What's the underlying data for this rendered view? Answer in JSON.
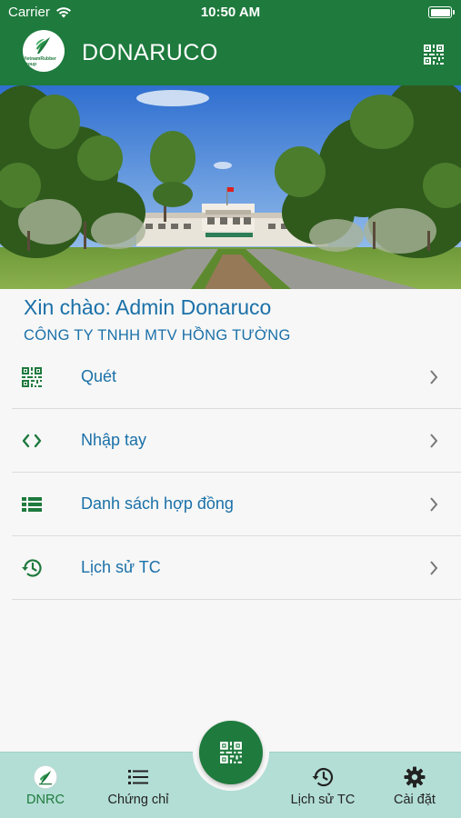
{
  "status_bar": {
    "carrier": "Carrier",
    "time": "10:50 AM"
  },
  "app_bar": {
    "title": "DONARUCO",
    "logo_text": "VietnamRubber Group"
  },
  "greeting": {
    "text": "Xin chào: Admin Donaruco",
    "company": "CÔNG TY TNHH MTV HỒNG TƯỜNG"
  },
  "menu": {
    "items": [
      {
        "label": "Quét",
        "icon": "qr-code-icon"
      },
      {
        "label": "Nhập tay",
        "icon": "code-brackets-icon"
      },
      {
        "label": "Danh sách hợp đồng",
        "icon": "list-icon"
      },
      {
        "label": "Lịch sử TC",
        "icon": "history-icon"
      }
    ]
  },
  "bottom_nav": {
    "items": [
      {
        "label": "DNRC",
        "icon": "logo-icon",
        "active": true
      },
      {
        "label": "Chứng chỉ",
        "icon": "list-icon"
      },
      {
        "label": "Lịch sử TC",
        "icon": "history-icon"
      },
      {
        "label": "Cài đặt",
        "icon": "gear-icon"
      }
    ],
    "fab_icon": "qr-code-icon"
  },
  "colors": {
    "primary": "#1e7a3d",
    "text_blue": "#1a70a8",
    "nav_bg": "#b3ded5"
  }
}
